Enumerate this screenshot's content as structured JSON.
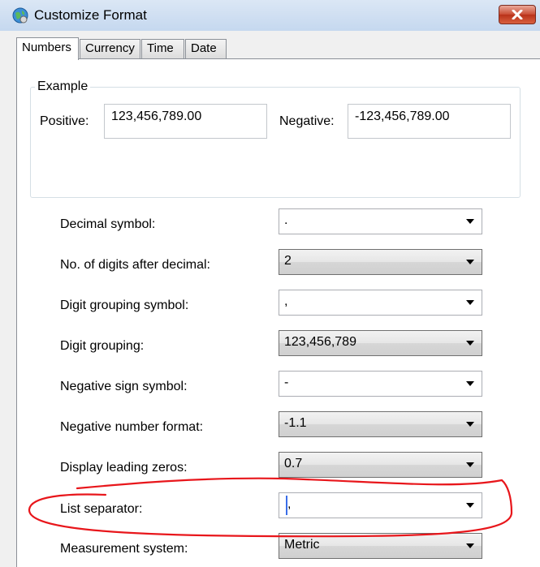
{
  "window": {
    "title": "Customize Format"
  },
  "tabs": [
    {
      "label": "Numbers",
      "active": true
    },
    {
      "label": "Currency",
      "active": false
    },
    {
      "label": "Time",
      "active": false
    },
    {
      "label": "Date",
      "active": false
    }
  ],
  "example": {
    "group_label": "Example",
    "positive_label": "Positive:",
    "positive_value": "123,456,789.00",
    "negative_label": "Negative:",
    "negative_value": "-123,456,789.00"
  },
  "settings": [
    {
      "label": "Decimal symbol:",
      "value": ".",
      "editable": true
    },
    {
      "label": "No. of digits after decimal:",
      "value": "2",
      "editable": false
    },
    {
      "label": "Digit grouping symbol:",
      "value": ",",
      "editable": true
    },
    {
      "label": "Digit grouping:",
      "value": "123,456,789",
      "editable": false
    },
    {
      "label": "Negative sign symbol:",
      "value": "-",
      "editable": true
    },
    {
      "label": "Negative number format:",
      "value": "-1.1",
      "editable": false
    },
    {
      "label": "Display leading zeros:",
      "value": "0.7",
      "editable": false
    },
    {
      "label": "List separator:",
      "value": ",",
      "editable": true
    },
    {
      "label": "Measurement system:",
      "value": "Metric",
      "editable": false
    }
  ],
  "colors": {
    "annotation": "#e8161b",
    "close_button": "#c94a31"
  },
  "icons": {
    "app": "globe-settings-icon",
    "close": "close-icon",
    "dropdown": "chevron-down-icon"
  }
}
